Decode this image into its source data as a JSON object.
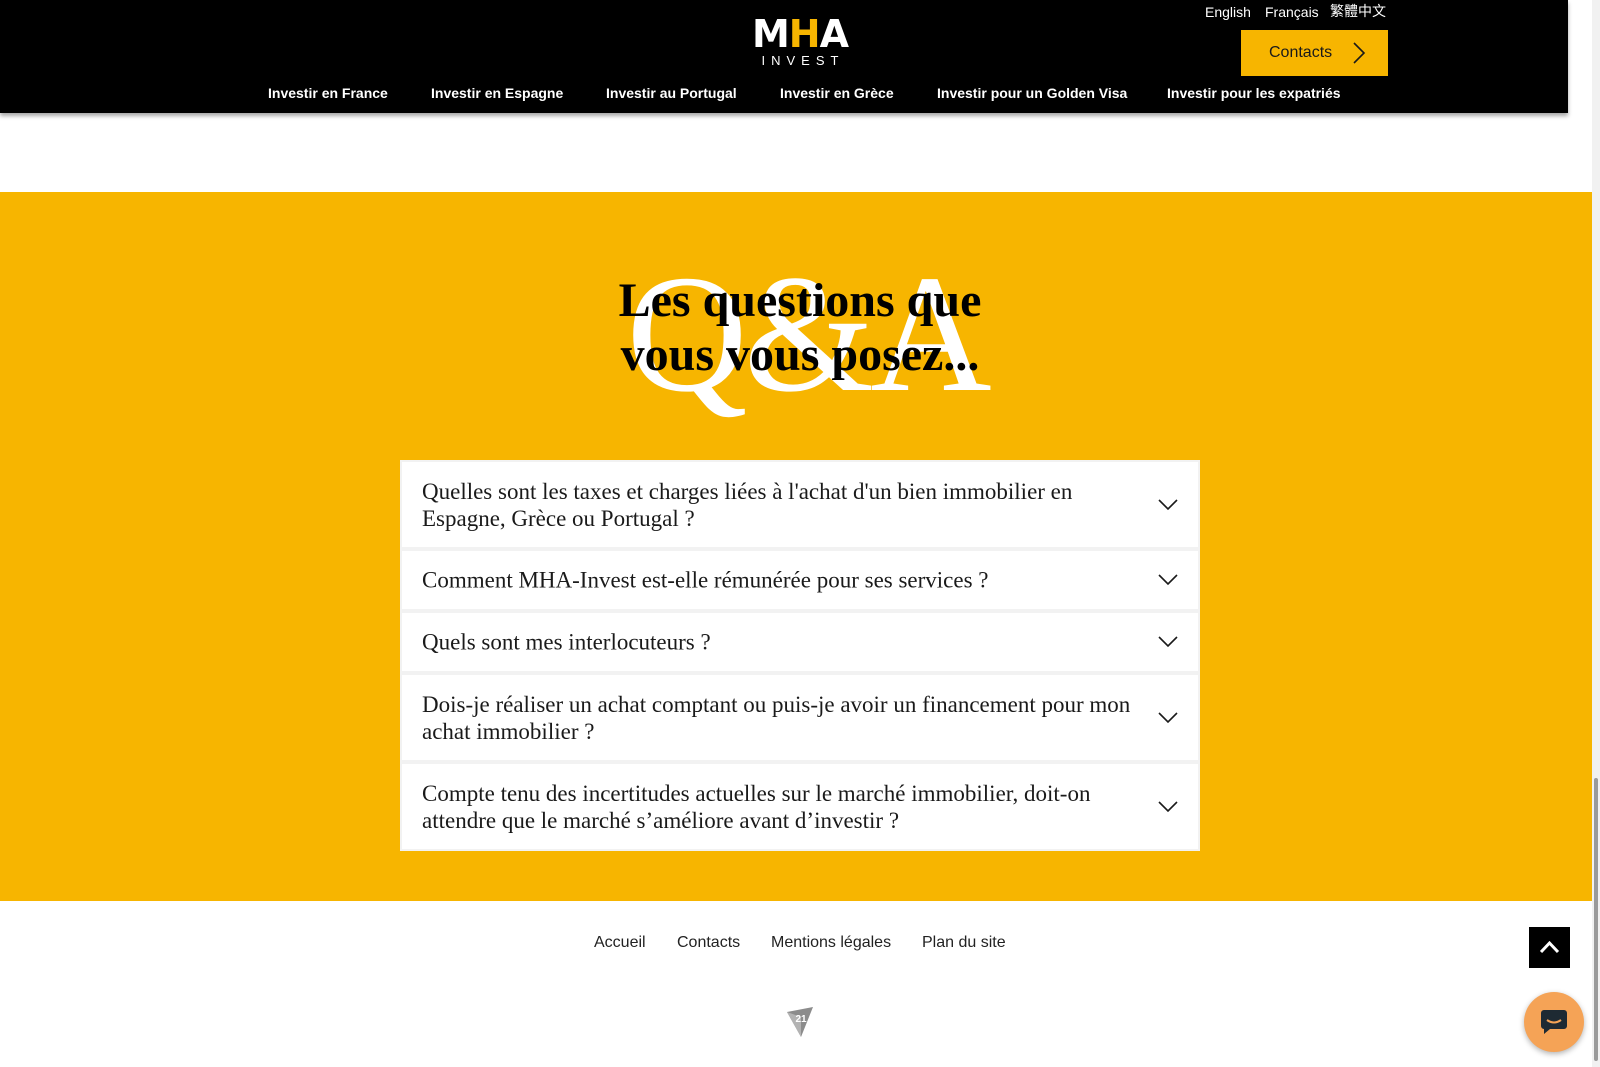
{
  "header": {
    "logo": {
      "main_prefix": "M",
      "main_accent": "H",
      "main_suffix": "A",
      "sub": "INVEST"
    },
    "languages": [
      "English",
      "Français",
      "繁體中文"
    ],
    "contacts_button": "Contacts",
    "nav": [
      "Investir en France",
      "Investir en Espagne",
      "Investir au Portugal",
      "Investir en Grèce",
      "Investir pour un Golden Visa",
      "Investir pour les expatriés"
    ]
  },
  "qa": {
    "background_text": "Q&A",
    "title_line1": "Les questions que",
    "title_line2": "vous vous posez...",
    "questions": [
      "Quelles sont les taxes et charges liées à l'achat d'un bien immobilier en Espagne, Grèce ou Portugal ?",
      "Comment MHA-Invest est-elle rémunérée pour ses services ?",
      "Quels sont mes interlocuteurs ?",
      "Dois-je réaliser un achat comptant ou puis-je avoir un financement pour mon achat immobilier ?",
      "Compte tenu des incertitudes actuelles sur le marché immobilier, doit-on attendre que le marché s’améliore avant d’investir ?"
    ]
  },
  "footer": {
    "links": [
      "Accueil",
      "Contacts",
      "Mentions légales",
      "Plan du site"
    ],
    "badge_number": "21"
  },
  "colors": {
    "brand_yellow": "#f7b500",
    "header_bg": "#000000",
    "chat_bubble": "#f5a356"
  },
  "icons": {
    "contacts_arrow": "chevron-right-icon",
    "faq_toggle": "chevron-down-icon",
    "back_to_top": "chevron-up-icon",
    "chat": "chat-bubble-icon",
    "footer_badge": "pin-badge-icon"
  }
}
